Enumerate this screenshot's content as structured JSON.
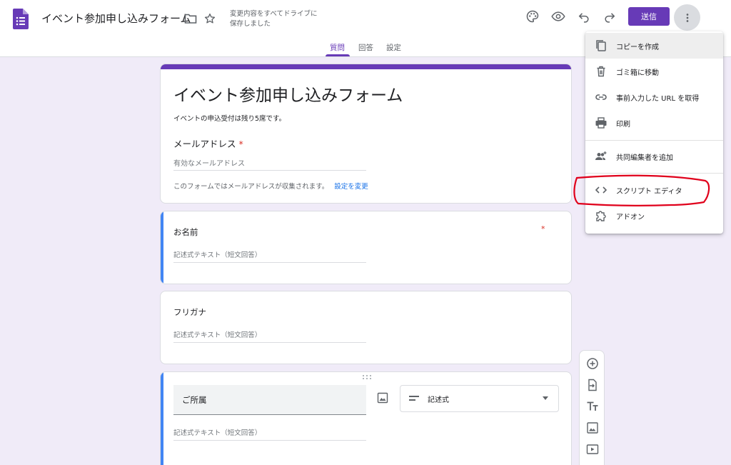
{
  "header": {
    "form_title": "イベント参加申し込みフォーム",
    "save_status": "変更内容をすべてドライブに保存しました",
    "send_label": "送信"
  },
  "tabs": [
    {
      "label": "質問",
      "active": true
    },
    {
      "label": "回答",
      "active": false
    },
    {
      "label": "設定",
      "active": false
    }
  ],
  "title_card": {
    "title": "イベント参加申し込みフォーム",
    "description": "イベントの申込受付は残り5席です。",
    "email_label": "メールアドレス",
    "required_mark": "*",
    "email_placeholder": "有効なメールアドレス",
    "collect_note": "このフォームではメールアドレスが収集されます。",
    "change_settings_link": "設定を変更"
  },
  "questions": [
    {
      "label": "お名前",
      "placeholder": "記述式テキスト（短文回答）",
      "required_mark": "*"
    },
    {
      "label": "フリガナ",
      "placeholder": "記述式テキスト（短文回答）"
    },
    {
      "label": "ご所属",
      "placeholder": "記述式テキスト（短文回答）",
      "type_label": "記述式"
    }
  ],
  "menu": {
    "items": [
      {
        "label": "コピーを作成",
        "icon": "copy-icon"
      },
      {
        "label": "ゴミ箱に移動",
        "icon": "trash-icon"
      },
      {
        "label": "事前入力した URL を取得",
        "icon": "link-icon"
      },
      {
        "label": "印刷",
        "icon": "print-icon"
      },
      {
        "label": "共同編集者を追加",
        "icon": "add-people-icon"
      },
      {
        "label": "スクリプト エディタ",
        "icon": "code-icon"
      },
      {
        "label": "アドオン",
        "icon": "puzzle-icon"
      }
    ]
  },
  "colors": {
    "accent": "#673ab7",
    "active_question": "#4285f4",
    "required": "#d93025",
    "link": "#1a73e8",
    "annotation": "#e0001b"
  }
}
